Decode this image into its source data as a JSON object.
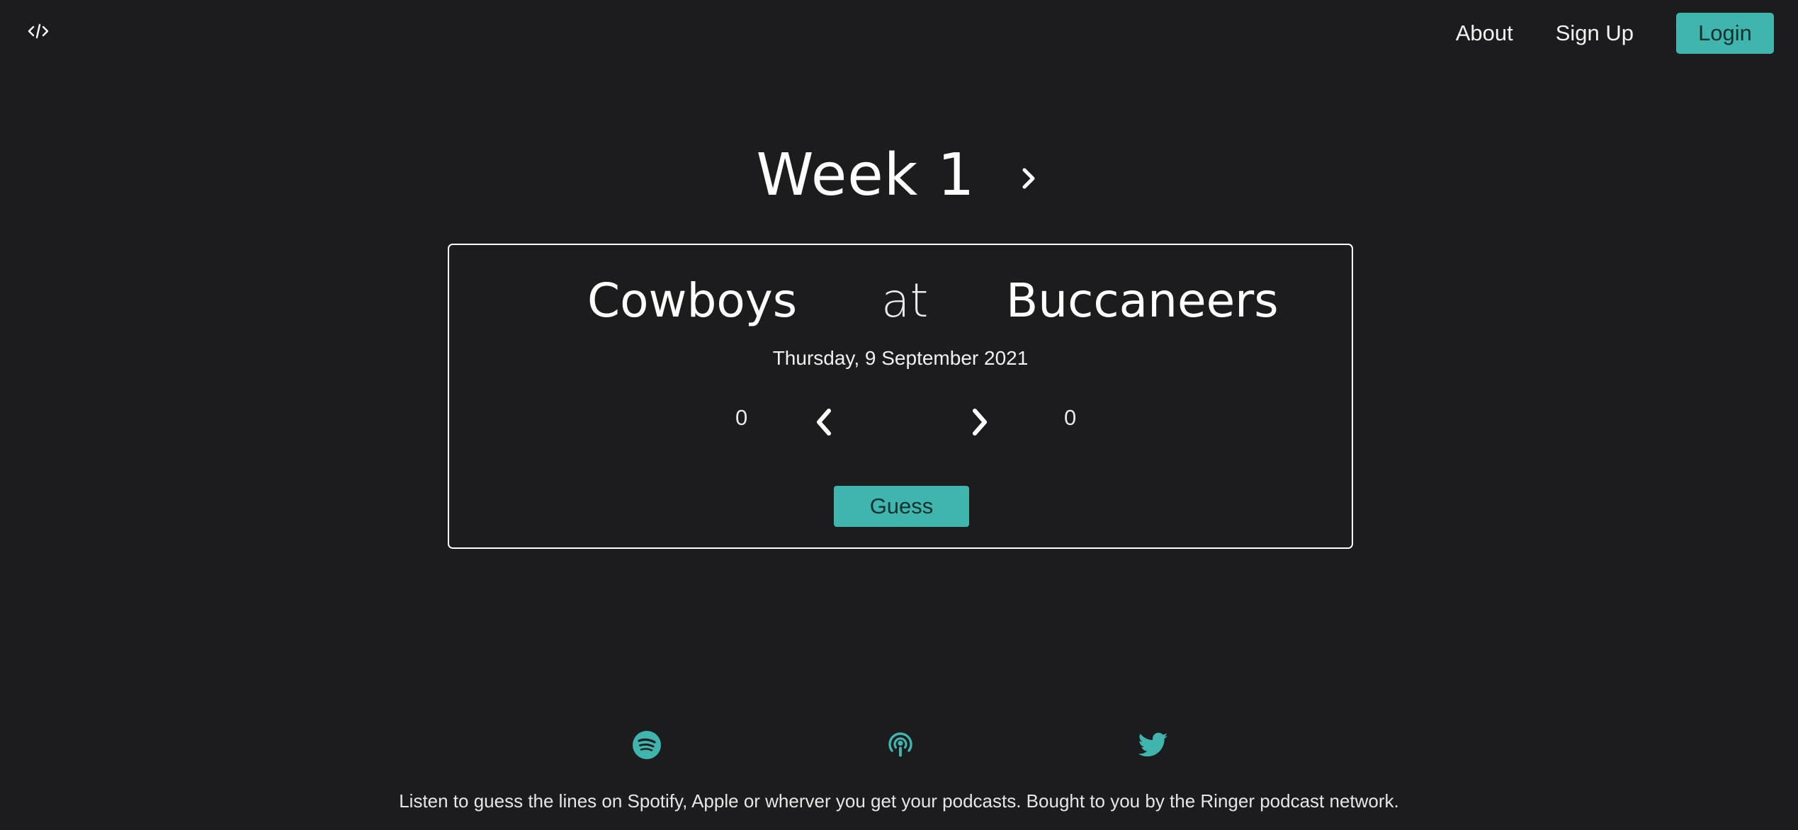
{
  "header": {
    "logo_icon": "code-icon",
    "nav": {
      "about": "About",
      "sign_up": "Sign Up",
      "login": "Login"
    }
  },
  "week": {
    "title": "Week 1",
    "next_icon": "chevron-right-icon"
  },
  "game": {
    "away_team": "Cowboys",
    "connector": "at",
    "home_team": "Buccaneers",
    "date": "Thursday, 9 September 2021",
    "away_score": "0",
    "home_score": "0",
    "guess_label": "Guess"
  },
  "footer": {
    "social": [
      "spotify-icon",
      "apple-podcasts-icon",
      "twitter-icon"
    ],
    "text": "Listen to guess the lines on Spotify, Apple or wherver you get your podcasts. Bought to you by the Ringer podcast network."
  },
  "colors": {
    "background": "#1c1c1e",
    "accent": "#3fb5ad",
    "text": "#ffffff"
  }
}
